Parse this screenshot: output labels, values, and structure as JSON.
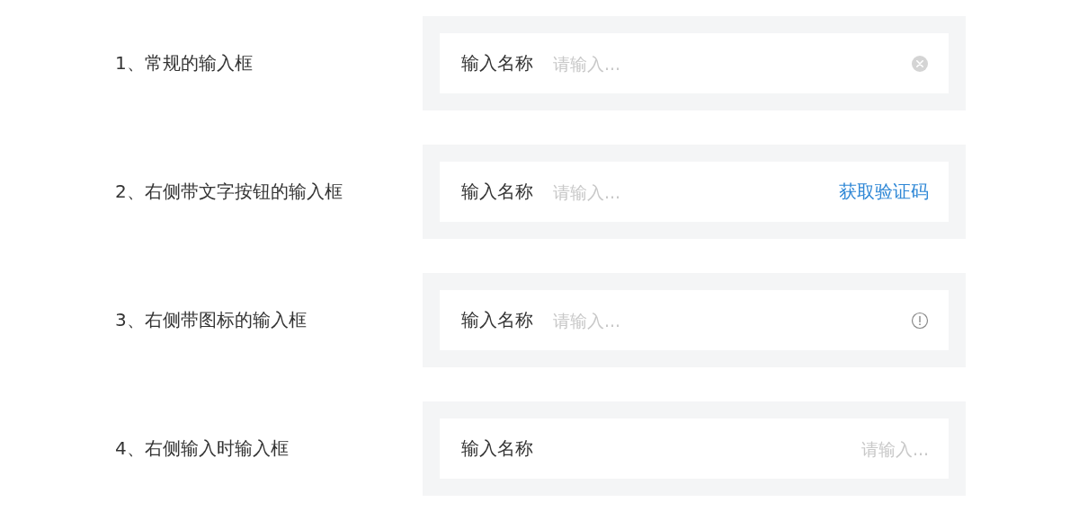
{
  "examples": [
    {
      "title": "1、常规的输入框",
      "label": "输入名称",
      "placeholder": "请输入...",
      "kind": "clear"
    },
    {
      "title": "2、右侧带文字按钮的输入框",
      "label": "输入名称",
      "placeholder": "请输入...",
      "kind": "text-button",
      "button": "获取验证码"
    },
    {
      "title": "3、右侧带图标的输入框",
      "label": "输入名称",
      "placeholder": "请输入...",
      "kind": "icon"
    },
    {
      "title": "4、右侧输入时输入框",
      "label": "输入名称",
      "placeholder": "请输入...",
      "kind": "right-aligned"
    }
  ]
}
